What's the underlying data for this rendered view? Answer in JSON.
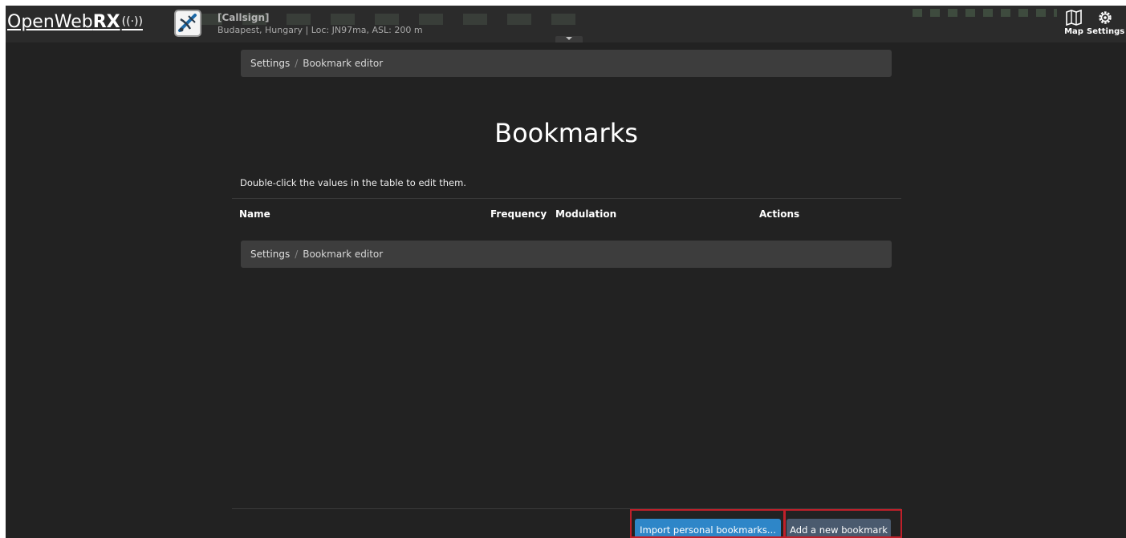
{
  "header": {
    "logo": {
      "prefix": "OpenWeb",
      "bold": "RX",
      "signal": "((·))"
    },
    "receiver": {
      "callsign": "[Callsign]",
      "location": "Budapest, Hungary | Loc: JN97ma, ASL: 200 m"
    },
    "buttons": {
      "map_label": "Map",
      "settings_label": "Settings"
    }
  },
  "breadcrumb": {
    "root": "Settings",
    "separator": "/",
    "current": "Bookmark editor"
  },
  "page": {
    "title": "Bookmarks",
    "hint": "Double-click the values in the table to edit them."
  },
  "table": {
    "columns": [
      "Name",
      "Frequency",
      "Modulation",
      "Actions"
    ]
  },
  "footer": {
    "import_label": "Import personal bookmarks...",
    "add_label": "Add a new bookmark"
  },
  "colors": {
    "background": "#222222",
    "primary_button": "#2e86c8",
    "secondary_button": "#4a5a6e",
    "highlight": "#c0202a"
  }
}
